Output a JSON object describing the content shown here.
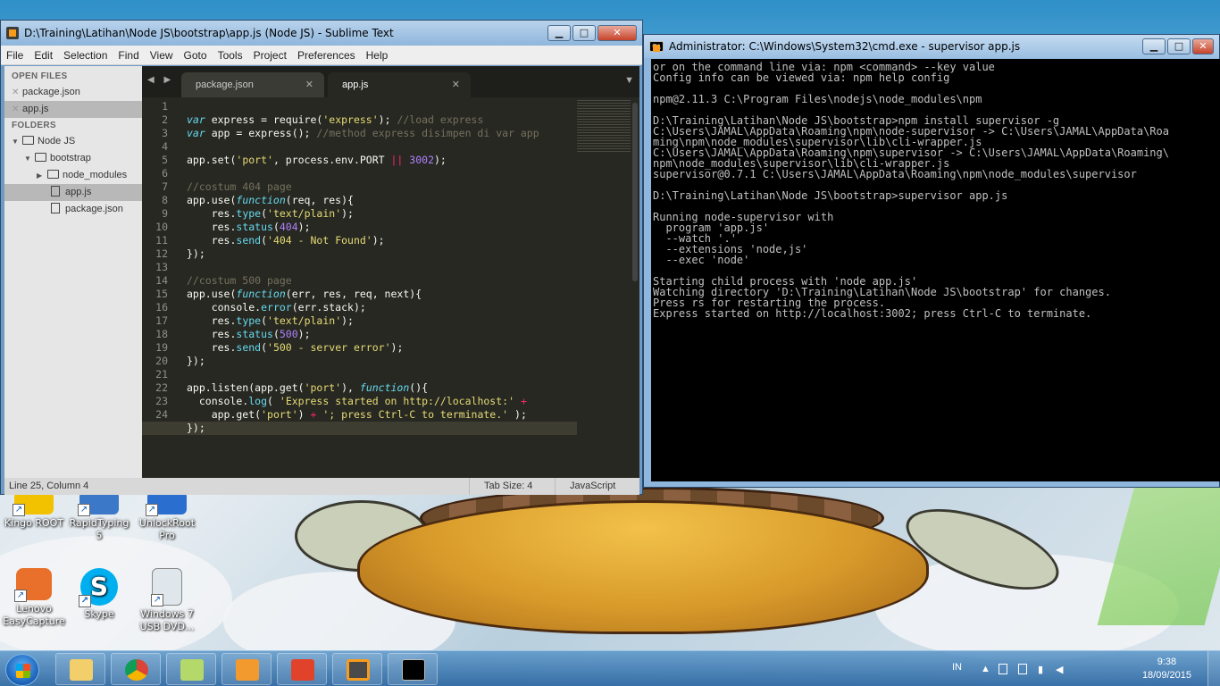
{
  "sublime": {
    "title": "D:\\Training\\Latihan\\Node JS\\bootstrap\\app.js (Node JS) - Sublime Text",
    "menu": [
      "File",
      "Edit",
      "Selection",
      "Find",
      "View",
      "Goto",
      "Tools",
      "Project",
      "Preferences",
      "Help"
    ],
    "sidebar": {
      "open_files_heading": "OPEN FILES",
      "open_files": [
        "package.json",
        "app.js"
      ],
      "folders_heading": "FOLDERS",
      "tree": [
        "Node JS",
        "bootstrap",
        "node_modules",
        "app.js",
        "package.json"
      ]
    },
    "tabs": [
      "package.json",
      "app.js"
    ],
    "status": {
      "position": "Line 25, Column 4",
      "tab_size": "Tab Size: 4",
      "syntax": "JavaScript"
    }
  },
  "cmd": {
    "title": "Administrator: C:\\Windows\\System32\\cmd.exe - supervisor  app.js",
    "icon_text": "C:\\",
    "lines": [
      "or on the command line via: npm <command> --key value",
      "Config info can be viewed via: npm help config",
      "",
      "npm@2.11.3 C:\\Program Files\\nodejs\\node_modules\\npm",
      "",
      "D:\\Training\\Latihan\\Node JS\\bootstrap>npm install supervisor -g",
      "C:\\Users\\JAMAL\\AppData\\Roaming\\npm\\node-supervisor -> C:\\Users\\JAMAL\\AppData\\Roa",
      "ming\\npm\\node_modules\\supervisor\\lib\\cli-wrapper.js",
      "C:\\Users\\JAMAL\\AppData\\Roaming\\npm\\supervisor -> C:\\Users\\JAMAL\\AppData\\Roaming\\",
      "npm\\node_modules\\supervisor\\lib\\cli-wrapper.js",
      "supervisor@0.7.1 C:\\Users\\JAMAL\\AppData\\Roaming\\npm\\node_modules\\supervisor",
      "",
      "D:\\Training\\Latihan\\Node JS\\bootstrap>supervisor app.js",
      "",
      "Running node-supervisor with",
      "  program 'app.js'",
      "  --watch '.'",
      "  --extensions 'node,js'",
      "  --exec 'node'",
      "",
      "Starting child process with 'node app.js'",
      "Watching directory 'D:\\Training\\Latihan\\Node JS\\bootstrap' for changes.",
      "Press rs for restarting the process.",
      "Express started on http://localhost:3002; press Ctrl-C to terminate."
    ]
  },
  "desktop_icons": [
    {
      "label": "Kingo ROOT"
    },
    {
      "label": "RapidTyping 5"
    },
    {
      "label": "UnlockRoot Pro"
    },
    {
      "label": "Lenovo EasyCapture"
    },
    {
      "label": "Skype"
    },
    {
      "label": "Windows 7 USB DVD..."
    }
  ],
  "taskbar": {
    "lang": "IN",
    "time": "9:38",
    "date": "18/09/2015"
  }
}
